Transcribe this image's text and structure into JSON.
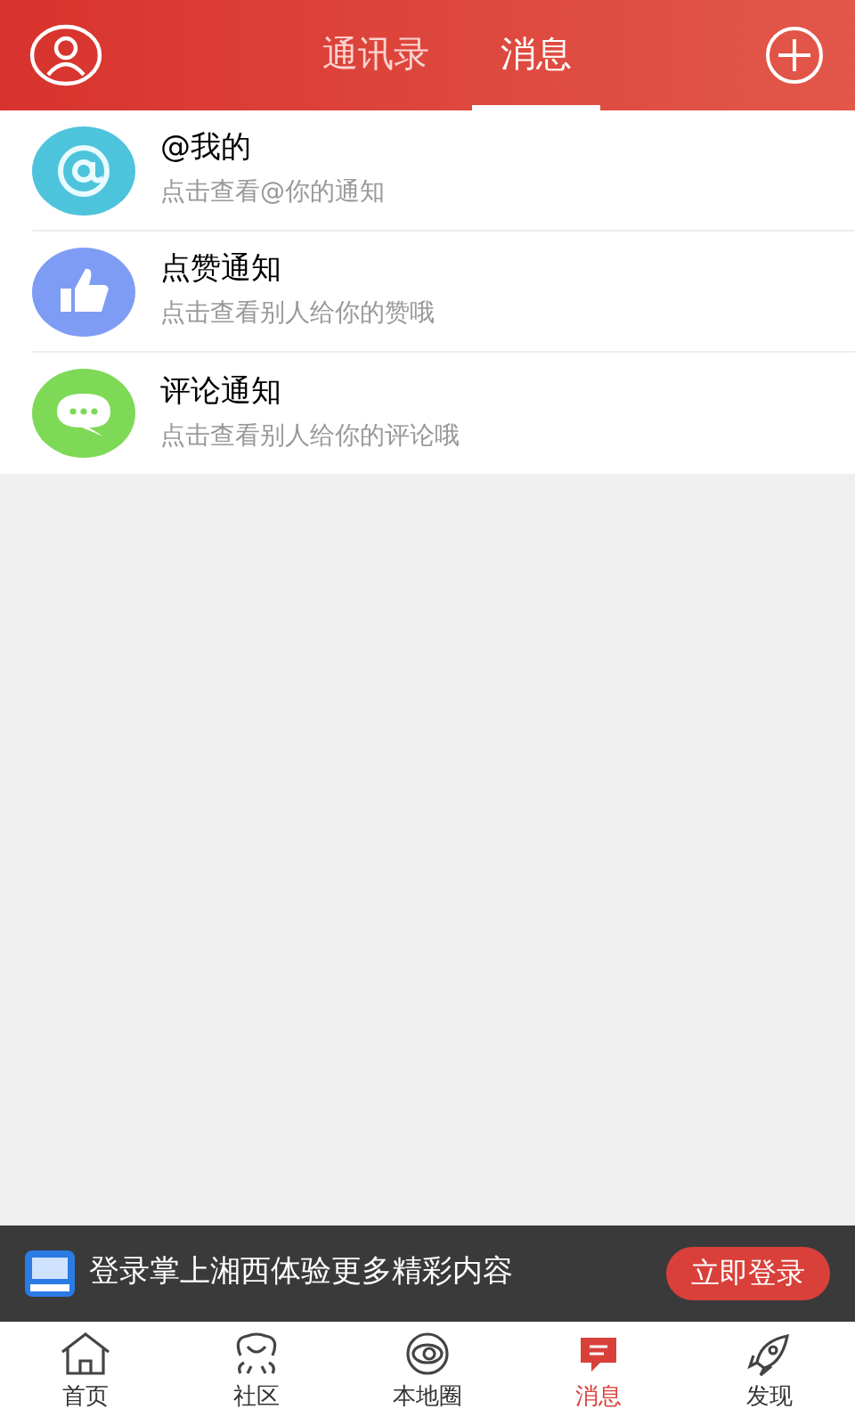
{
  "header": {
    "tabs": [
      {
        "label": "通讯录",
        "selected": false
      },
      {
        "label": "消息",
        "selected": true
      }
    ]
  },
  "notifications": [
    {
      "kind": "mention",
      "title": "@我的",
      "subtitle": "点击查看@你的通知"
    },
    {
      "kind": "like",
      "title": "点赞通知",
      "subtitle": "点击查看别人给你的赞哦"
    },
    {
      "kind": "comment",
      "title": "评论通知",
      "subtitle": "点击查看别人给你的评论哦"
    }
  ],
  "login_banner": {
    "text": "登录掌上湘西体验更多精彩内容",
    "button": "立即登录"
  },
  "bottom_nav": [
    {
      "kind": "home",
      "label": "首页",
      "selected": false
    },
    {
      "kind": "community",
      "label": "社区",
      "selected": false
    },
    {
      "kind": "local",
      "label": "本地圈",
      "selected": false
    },
    {
      "kind": "message",
      "label": "消息",
      "selected": true
    },
    {
      "kind": "discover",
      "label": "发现",
      "selected": false
    }
  ]
}
